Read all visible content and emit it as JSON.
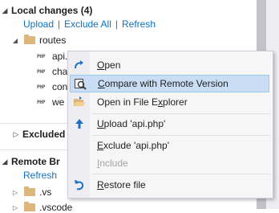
{
  "panel": {
    "local_changes": {
      "title": "Local changes (4)",
      "actions": [
        "Upload",
        "Exclude All",
        "Refresh"
      ]
    },
    "routes_folder": "routes",
    "files": [
      {
        "icon_label": "PHP",
        "name": "api."
      },
      {
        "icon_label": "PHP",
        "name": "cha"
      },
      {
        "icon_label": "PHP",
        "name": "con"
      },
      {
        "icon_label": "PHP",
        "name": "we"
      }
    ],
    "excluded": {
      "title": "Excluded ("
    },
    "remote": {
      "title": "Remote Br",
      "refresh": "Refresh",
      "folders": [
        ".vs",
        ".vscode"
      ]
    }
  },
  "context_menu": {
    "items": [
      {
        "pre": "",
        "key": "O",
        "post": "pen",
        "icon": "open-icon",
        "state": "normal"
      },
      {
        "pre": "",
        "key": "C",
        "post": "ompare with Remote Version",
        "icon": "compare-icon",
        "state": "selected"
      },
      {
        "pre": "Open in File E",
        "key": "x",
        "post": "plorer",
        "icon": "folder-open-icon",
        "state": "normal"
      },
      {
        "pre": "",
        "key": "U",
        "post": "pload 'api.php'",
        "icon": "upload-arrow-icon",
        "state": "normal"
      },
      {
        "pre": "",
        "key": "E",
        "post": "xclude 'api.php'",
        "icon": "",
        "state": "normal"
      },
      {
        "pre": "",
        "key": "I",
        "post": "nclude",
        "icon": "",
        "state": "disabled"
      },
      {
        "pre": "",
        "key": "R",
        "post": "estore file",
        "icon": "undo-icon",
        "state": "normal"
      }
    ]
  },
  "colors": {
    "link": "#0e70c0",
    "selection_bg": "#c9def5",
    "selection_border": "#99c9ef",
    "folder": "#dcb67a",
    "icon_blue": "#1e6fc4"
  }
}
